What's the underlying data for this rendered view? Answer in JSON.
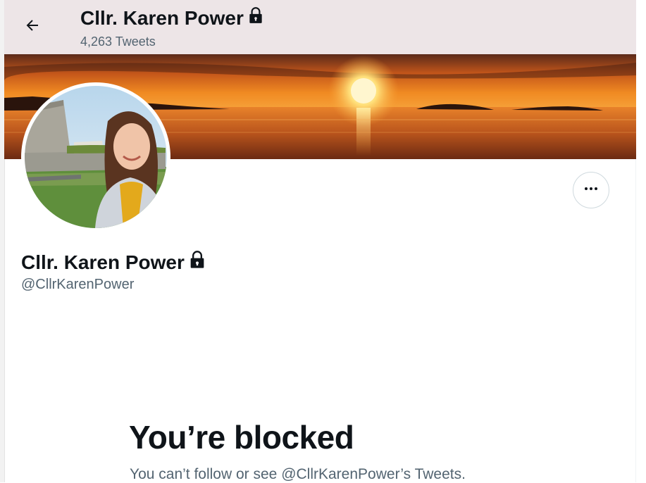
{
  "header": {
    "back_icon": "arrow-left-icon",
    "name": "Cllr. Karen Power",
    "tweet_count": "4,263 Tweets",
    "lock_icon": "lock-icon"
  },
  "profile": {
    "name": "Cllr. Karen Power",
    "handle": "@CllrKarenPower",
    "more_icon": "more-horizontal-icon"
  },
  "blocked": {
    "title": "You’re blocked",
    "message": "You can’t follow or see @CllrKarenPower’s Tweets."
  },
  "colors": {
    "text_primary": "#0f1419",
    "text_secondary": "#536471",
    "border": "#cfd9de"
  }
}
